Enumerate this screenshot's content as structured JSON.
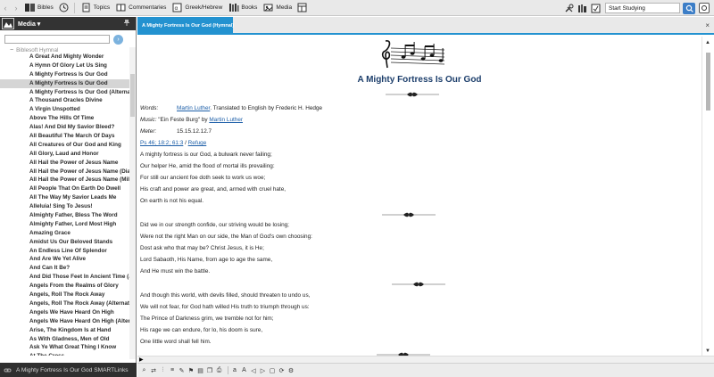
{
  "toolbar": {
    "items": [
      {
        "label": "Bibles",
        "icon": "bibles-icon"
      },
      {
        "label": "Topics",
        "icon": "topics-icon"
      },
      {
        "label": "Commentaries",
        "icon": "commentaries-icon"
      },
      {
        "label": "Greek/Hebrew",
        "icon": "greek-hebrew-icon"
      },
      {
        "label": "Books",
        "icon": "books-icon"
      },
      {
        "label": "Media",
        "icon": "media-icon"
      }
    ],
    "study_input_value": "Start Studying"
  },
  "left_panel": {
    "title": "Media ▾",
    "search_value": "",
    "go_glyph": "›",
    "tree_root": "Biblesoft Hymnal",
    "tree_root_toggle": "−",
    "selected_index": 3,
    "hymns": [
      "A Great And Mighty Wonder",
      "A Hymn Of Glory Let Us Sing",
      "A Mighty Fortress Is Our God",
      "A Mighty Fortress Is Our God",
      "A Mighty Fortress Is Our God (Alternate",
      "A Thousand Oracles Divine",
      "A Virgin Unspotted",
      "Above The Hills Of Time",
      "Alas! And Did My Savior Bleed?",
      "All Beautiful The March Of Days",
      "All Creatures of Our God and King",
      "All Glory, Laud and Honor",
      "All Hail the Power of Jesus Name",
      "All Hail the Power of Jesus Name (Diade",
      "All Hail the Power of Jesus Name (Miles",
      "All People That On Earth Do Dwell",
      "All The Way My Savior Leads Me",
      "Alleluia!  Sing To Jesus!",
      "Almighty Father, Bless The Word",
      "Almighty Father, Lord Most High",
      "Amazing Grace",
      "Amidst Us Our Beloved Stands",
      "An Endless Line Of Splendor",
      "And Are We Yet Alive",
      "And Can It Be?",
      "And Did Those Feet In Ancient Time (Je",
      "Angels From the Realms of Glory",
      "Angels, Roll The Rock Away",
      "Angels, Roll The Rock Away (Alternate v",
      "Angels We Have Heard On High",
      "Angels We Have Heard On High (Altern",
      "Arise, The Kingdom Is at Hand",
      "As With Gladness, Men of Old",
      "Ask Ye What Great Thing I Know",
      "At The Cross"
    ]
  },
  "tab": {
    "label": "A Mighty Fortress Is Our God (Hymnal)",
    "close_glyph": "×"
  },
  "document": {
    "title": "A Mighty Fortress Is Our God",
    "words_label": "Words:",
    "words_author": "Martin Luther",
    "words_rest": ". Translated to English by Frederic H. Hedge",
    "music_label": "Music:",
    "music_text": " \"Ein Feste Burg\" by ",
    "music_author": "Martin Luther",
    "meter_label": "Meter:",
    "meter_value": "15.15.12.12.7",
    "refs": "Ps 46; 18:2; 61:3",
    "refs_sep": " / ",
    "refuge": "Refuge",
    "stanzas": [
      [
        "A mighty fortress is our God, a bulwark never failing;",
        "Our helper He, amid the flood of mortal ills prevailing:",
        "For still our ancient foe doth seek to work us woe;",
        "His craft and power are great, and, armed with cruel hate,",
        "On earth is not his equal."
      ],
      [
        "Did we in our strength confide, our striving would be losing;",
        "Were not the right Man on our side, the Man of God's own choosing:",
        "Dost ask who that may be? Christ Jesus, it is He;",
        "Lord Sabaoth, His Name, from age to age the same,",
        "And He must win the battle."
      ],
      [
        "And though this world, with devils filled, should threaten to undo us,",
        "We will not fear, for God hath willed His truth to triumph through us:",
        "The Prince of Darkness grim, we tremble not for him;",
        "His rage we can endure, for lo, his doom is sure,",
        "One little word shall fell him."
      ]
    ]
  },
  "status": {
    "smartlinks_label": "A Mighty Fortress Is Our God SMARTLinks"
  }
}
